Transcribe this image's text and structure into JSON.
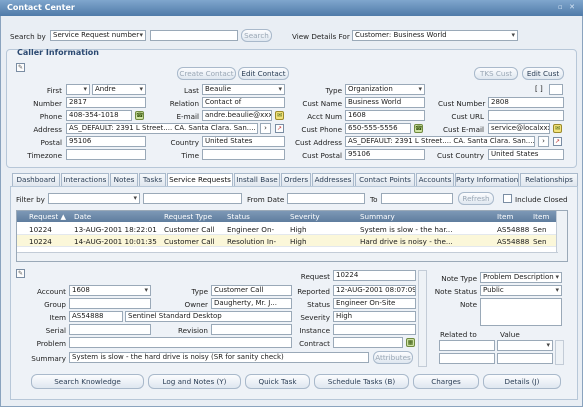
{
  "window": {
    "title": "Contact Center",
    "controls": "▫ ✕"
  },
  "search": {
    "label": "Search by",
    "by_value": "Service Request number",
    "query": "",
    "button": "Search",
    "view_label": "View Details For",
    "view_value": "Customer: Business World"
  },
  "caller": {
    "section_title": "Caller Information",
    "buttons": {
      "create": "Create Contact",
      "edit": "Edit Contact",
      "tks": "TKS Cust",
      "edit_cust": "Edit Cust"
    },
    "first_label": "First",
    "first_prefix": "",
    "first_value": "Andre",
    "last_label": "Last",
    "last_value": "Beaulie",
    "type_label": "Type",
    "type_value": "Organization",
    "number_label": "Number",
    "number_value": "2817",
    "relation_label": "Relation",
    "relation_value": "Contact of",
    "cust_name_label": "Cust Name",
    "cust_name_value": "Business World",
    "cust_number_label": "Cust Number",
    "cust_number_value": "2808",
    "phone_label": "Phone",
    "phone_value": "408-354-1018",
    "email_label": "E-mail",
    "email_value": "andre.beaulie@xxx",
    "acct_num_label": "Acct Num",
    "acct_num_value": "1608",
    "cust_url_label": "Cust URL",
    "cust_url_value": "",
    "address_label": "Address",
    "address_value": "AS_DEFAULT: 2391 L Street.... CA. Santa Clara. San....",
    "cust_phone_label": "Cust Phone",
    "cust_phone_value": "650-555-5556",
    "cust_email_label": "Cust E-mail",
    "cust_email_value": "service@localxxx",
    "postal_label": "Postal",
    "postal_value": "95106",
    "country_label": "Country",
    "country_value": "United States",
    "cust_address_label": "Cust Address",
    "cust_address_value": "AS_DEFAULT: 2391 L Street.... CA. Santa Clara. San....",
    "timezone_label": "Timezone",
    "timezone_value": "",
    "time_label": "Time",
    "time_value": "",
    "cust_postal_label": "Cust Postal",
    "cust_postal_value": "95106",
    "cust_country_label": "Cust Country",
    "cust_country_value": "United States"
  },
  "tabs": [
    "Dashboard",
    "Interactions",
    "Notes",
    "Tasks",
    "Service Requests",
    "Install Base",
    "Orders",
    "Addresses",
    "Contact Points",
    "Accounts",
    "Party Information",
    "Relationships"
  ],
  "active_tab": "Service Requests",
  "filter": {
    "label": "Filter by",
    "value": "",
    "from_label": "From Date",
    "to_label": "To",
    "refresh": "Refresh",
    "include_closed": "Include Closed"
  },
  "table": {
    "headers": [
      "Request ▲",
      "Date",
      "Request Type",
      "Status",
      "Severity",
      "Summary",
      "Item",
      "Item"
    ],
    "rows": [
      [
        "10224",
        "13-AUG-2001 18:22:01",
        "Customer Call",
        "Engineer On-",
        "High",
        "System is slow - the har...",
        "AS54888",
        "Sen"
      ],
      [
        "10224",
        "14-AUG-2001 10:01:35",
        "Customer Call",
        "Resolution In-",
        "High",
        "Hard drive is noisy - the...",
        "AS54888",
        "Sen"
      ]
    ]
  },
  "detail": {
    "account_label": "Account",
    "account_value": "1608",
    "type_label": "Type",
    "type_value": "Customer Call",
    "request_label": "Request",
    "request_value": "10224",
    "group_label": "Group",
    "group_value": "",
    "owner_label": "Owner",
    "owner_value": "Daugherty, Mr. J...",
    "reported_label": "Reported",
    "reported_value": "12-AUG-2001 08:07:09",
    "item_label": "Item",
    "item_value": "AS54888",
    "item_desc": "Sentinel Standard Desktop",
    "status_label": "Status",
    "status_value": "Engineer On-Site",
    "serial_label": "Serial",
    "serial_value": "",
    "revision_label": "Revision",
    "revision_value": "",
    "severity_label": "Severity",
    "severity_value": "High",
    "problem_label": "Problem",
    "problem_value": "",
    "instance_label": "Instance",
    "instance_value": "",
    "contract_label": "Contract",
    "contract_value": "",
    "summary_label": "Summary",
    "summary_value": "System is slow - the hard drive is noisy (SR for sanity check)",
    "attributes_button": "Attributes",
    "note_type_label": "Note Type",
    "note_type_value": "Problem Description",
    "note_status_label": "Note Status",
    "note_status_value": "Public",
    "note_label": "Note",
    "note_value": "",
    "related_label": "Related to",
    "value_label": "Value"
  },
  "footer_buttons": [
    "Search Knowledge",
    "Log and Notes (Y)",
    "Quick Task",
    "Schedule Tasks (B)",
    "Charges",
    "Details (J)"
  ]
}
